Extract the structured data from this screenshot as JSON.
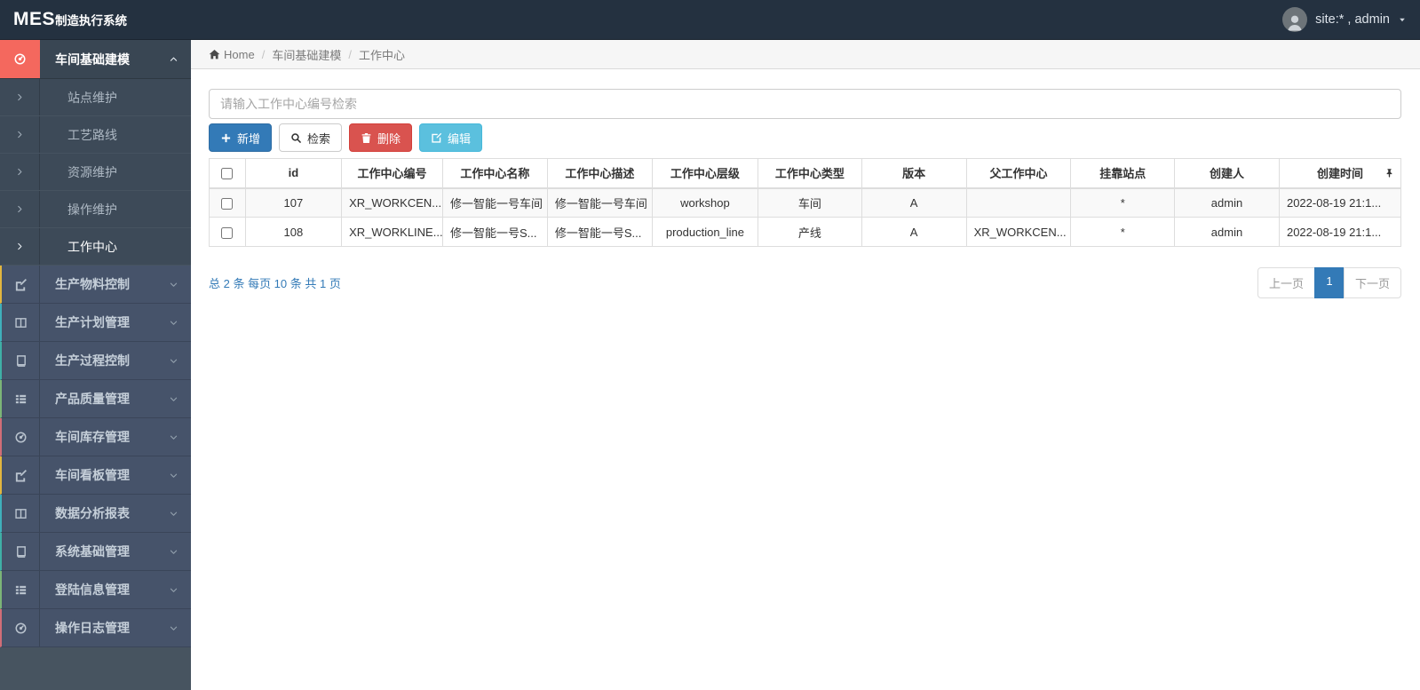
{
  "navbar": {
    "brand_bold": "MES",
    "brand_rest": "制造执行系统",
    "user_label": "site:* , admin",
    "avatar_icon": "user-avatar",
    "caret_icon": "caret-down-icon"
  },
  "breadcrumb": {
    "home_icon": "home-icon",
    "home": "Home",
    "separator": "/",
    "section": "车间基础建模",
    "page": "工作中心"
  },
  "search": {
    "placeholder": "请输入工作中心编号检索"
  },
  "toolbar": {
    "add": {
      "label": "新增",
      "icon": "plus-icon"
    },
    "search": {
      "label": "检索",
      "icon": "search-icon"
    },
    "delete": {
      "label": "删除",
      "icon": "trash-icon"
    },
    "edit": {
      "label": "编辑",
      "icon": "edit-square-icon"
    }
  },
  "sidebar": {
    "parent": {
      "key": "workshop-basic-modeling",
      "label": "车间基础建模",
      "icon": "dashboard-icon",
      "chevron": "chevron-up-icon",
      "icon_bg": "#f4685e"
    },
    "submenu": [
      {
        "key": "station-maintenance",
        "label": "站点维护",
        "active": false
      },
      {
        "key": "process-route",
        "label": "工艺路线",
        "active": false
      },
      {
        "key": "resource-maintenance",
        "label": "资源维护",
        "active": false
      },
      {
        "key": "operation-maintenance",
        "label": "操作维护",
        "active": false
      },
      {
        "key": "work-center",
        "label": "工作中心",
        "active": true
      }
    ],
    "submenu_item_icon": "chevron-right-icon",
    "section_chevron": "chevron-down-icon",
    "sections": [
      {
        "key": "production-material-control",
        "label": "生产物料控制",
        "icon": "edit-icon",
        "accent": "#e2b63f"
      },
      {
        "key": "production-plan-management",
        "label": "生产计划管理",
        "icon": "columns-icon",
        "accent": "#3fb0bb"
      },
      {
        "key": "production-process-control",
        "label": "生产过程控制",
        "icon": "book-icon",
        "accent": "#3fb0a6"
      },
      {
        "key": "product-quality-management",
        "label": "产品质量管理",
        "icon": "list-icon",
        "accent": "#7cb577"
      },
      {
        "key": "workshop-inventory-management",
        "label": "车间库存管理",
        "icon": "dashboard-icon",
        "accent": "#d16d77"
      },
      {
        "key": "workshop-kanban-management",
        "label": "车间看板管理",
        "icon": "edit-icon",
        "accent": "#e2b63f"
      },
      {
        "key": "data-analysis-report",
        "label": "数据分析报表",
        "icon": "columns-icon",
        "accent": "#3fb0bb"
      },
      {
        "key": "system-basic-management",
        "label": "系统基础管理",
        "icon": "book-icon",
        "accent": "#3fb0a6"
      },
      {
        "key": "login-info-management",
        "label": "登陆信息管理",
        "icon": "list-icon",
        "accent": "#7cb577"
      },
      {
        "key": "operation-log-management",
        "label": "操作日志管理",
        "icon": "dashboard-icon",
        "accent": "#d16d77"
      }
    ]
  },
  "table": {
    "pin_icon": "pin-icon",
    "columns": [
      "id",
      "工作中心编号",
      "工作中心名称",
      "工作中心描述",
      "工作中心层级",
      "工作中心类型",
      "版本",
      "父工作中心",
      "挂靠站点",
      "创建人",
      "创建时间"
    ],
    "rows": [
      [
        "107",
        "XR_WORKCEN...",
        "修一智能一号车间",
        "修一智能一号车间",
        "workshop",
        "车间",
        "A",
        "",
        "*",
        "admin",
        "2022-08-19 21:1..."
      ],
      [
        "108",
        "XR_WORKLINE...",
        "修一智能一号S...",
        "修一智能一号S...",
        "production_line",
        "产线",
        "A",
        "XR_WORKCEN...",
        "*",
        "admin",
        "2022-08-19 21:1..."
      ]
    ]
  },
  "pagination": {
    "summary": "总 2 条 每页 10 条 共 1 页",
    "prev": "上一页",
    "page": "1",
    "next": "下一页"
  },
  "colors": {
    "navbar_bg": "#243140",
    "sidebar_bg": "#475460",
    "sidebar_item_bg": "#46536a",
    "sidebar_submenu_bg": "#3d4a58",
    "active_parent_icon_bg": "#f4685e",
    "primary": "#337ab7",
    "danger": "#d9534f",
    "info": "#5bc0de",
    "link_blue": "#337ab7"
  }
}
